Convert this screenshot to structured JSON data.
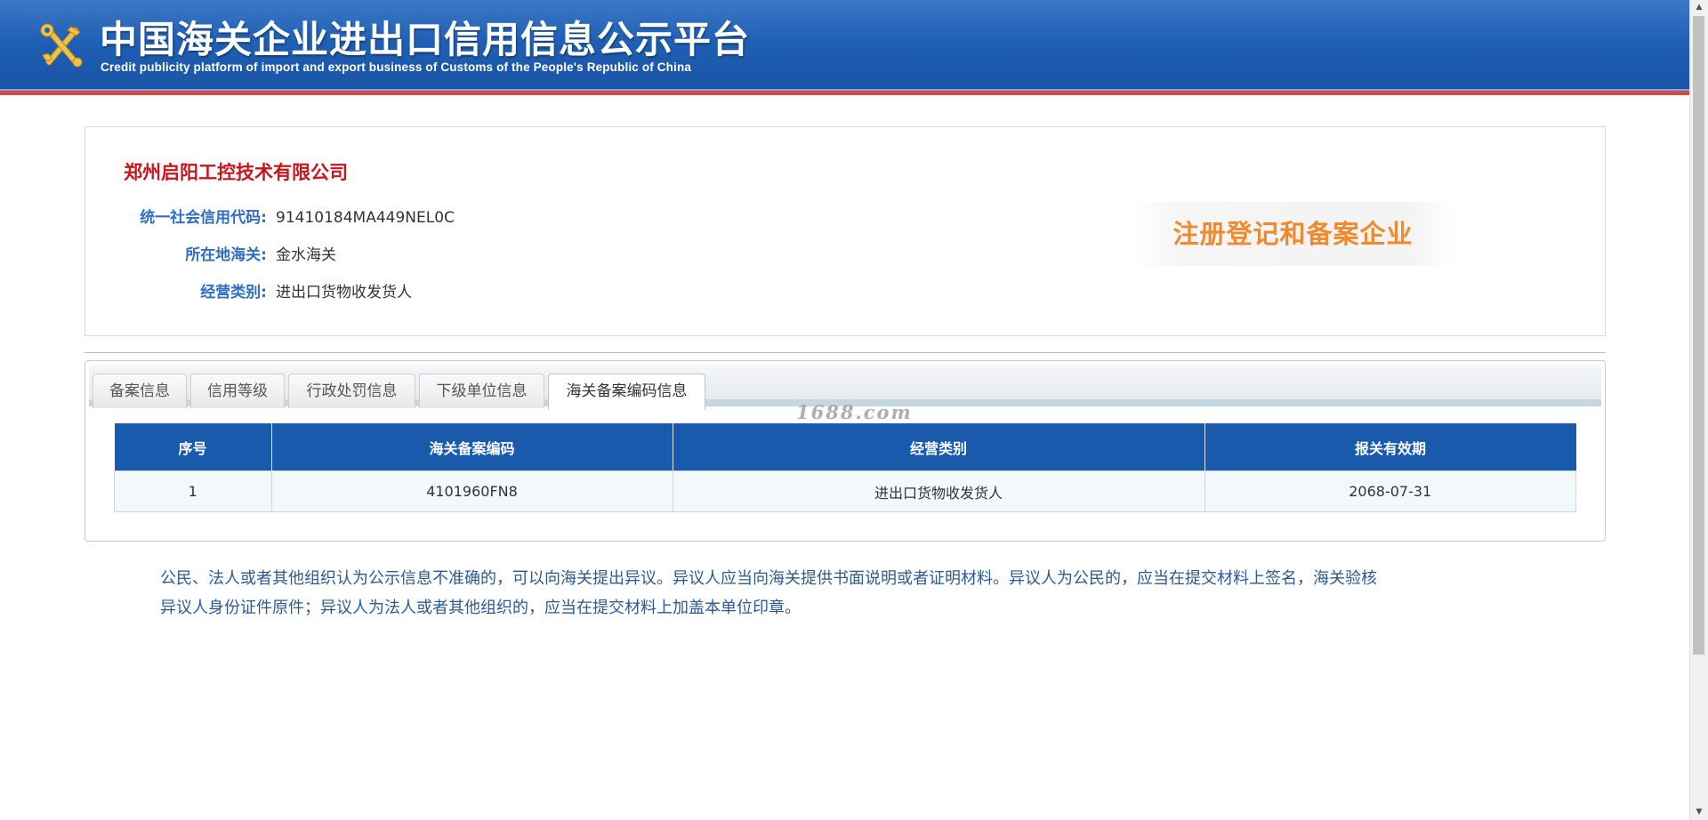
{
  "header": {
    "title": "中国海关企业进出口信用信息公示平台",
    "subtitle": "Credit publicity platform of import and export business of Customs of the People's Republic of China"
  },
  "company": {
    "name": "郑州启阳工控技术有限公司",
    "fields": [
      {
        "label": "统一社会信用代码:",
        "value": "91410184MA449NEL0C"
      },
      {
        "label": "所在地海关:",
        "value": "金水海关"
      },
      {
        "label": "经营类别:",
        "value": "进出口货物收发货人"
      }
    ],
    "badge": "注册登记和备案企业"
  },
  "tabs": [
    {
      "label": "备案信息",
      "active": false
    },
    {
      "label": "信用等级",
      "active": false
    },
    {
      "label": "行政处罚信息",
      "active": false
    },
    {
      "label": "下级单位信息",
      "active": false
    },
    {
      "label": "海关备案编码信息",
      "active": true
    }
  ],
  "watermark": "1688.com",
  "table": {
    "headers": [
      "序号",
      "海关备案编码",
      "经营类别",
      "报关有效期"
    ],
    "rows": [
      [
        "1",
        "4101960FN8",
        "进出口货物收发货人",
        "2068-07-31"
      ]
    ]
  },
  "notice": {
    "line1": "公民、法人或者其他组织认为公示信息不准确的，可以向海关提出异议。异议人应当向海关提供书面说明或者证明材料。异议人为公民的，应当在提交材料上签名，海关验核",
    "line2": "异议人身份证件原件；异议人为法人或者其他组织的，应当在提交材料上加盖本单位印章。"
  },
  "icons": {
    "emblem": "customs-emblem-icon",
    "scroll_up": "scroll-up-icon",
    "scroll_down": "scroll-down-icon"
  },
  "colors": {
    "header_blue": "#1f5fb4",
    "company_name_red": "#c8161d",
    "label_blue": "#2f6ec1",
    "badge_orange": "#f08a2c",
    "table_header_blue": "#1a5aad",
    "notice_blue": "#2a5b94"
  }
}
